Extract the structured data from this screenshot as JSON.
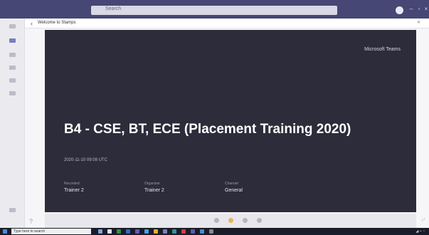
{
  "search": {
    "placeholder": "Search"
  },
  "panel": {
    "title": "Welcome to Stamps"
  },
  "video": {
    "brand": "Microsoft Teams",
    "meeting_title": "B4 - CSE, BT, ECE (Placement Training 2020)",
    "meeting_time": "2020-11-10 09:08 UTC",
    "meta": [
      {
        "label": "Recorded",
        "value": "Trainer 2"
      },
      {
        "label": "Organizer",
        "value": "Trainer 2"
      },
      {
        "label": "Channel",
        "value": "General"
      }
    ]
  },
  "taskbar": {
    "search_placeholder": "Type here to search",
    "icon_colors": [
      "#7aa6e0",
      "#e4e4e4",
      "#3b8d44",
      "#2f6cc0",
      "#5e5eb8",
      "#46a0e0",
      "#e0b030",
      "#7a7fbb",
      "#3a8f8f",
      "#d04040",
      "#5b5ea6",
      "#4a8ad0",
      "#888"
    ]
  },
  "colors": {
    "titlebar": "#464775",
    "video_bg": "#2d2c3a",
    "accent": "#7a7fbb"
  }
}
